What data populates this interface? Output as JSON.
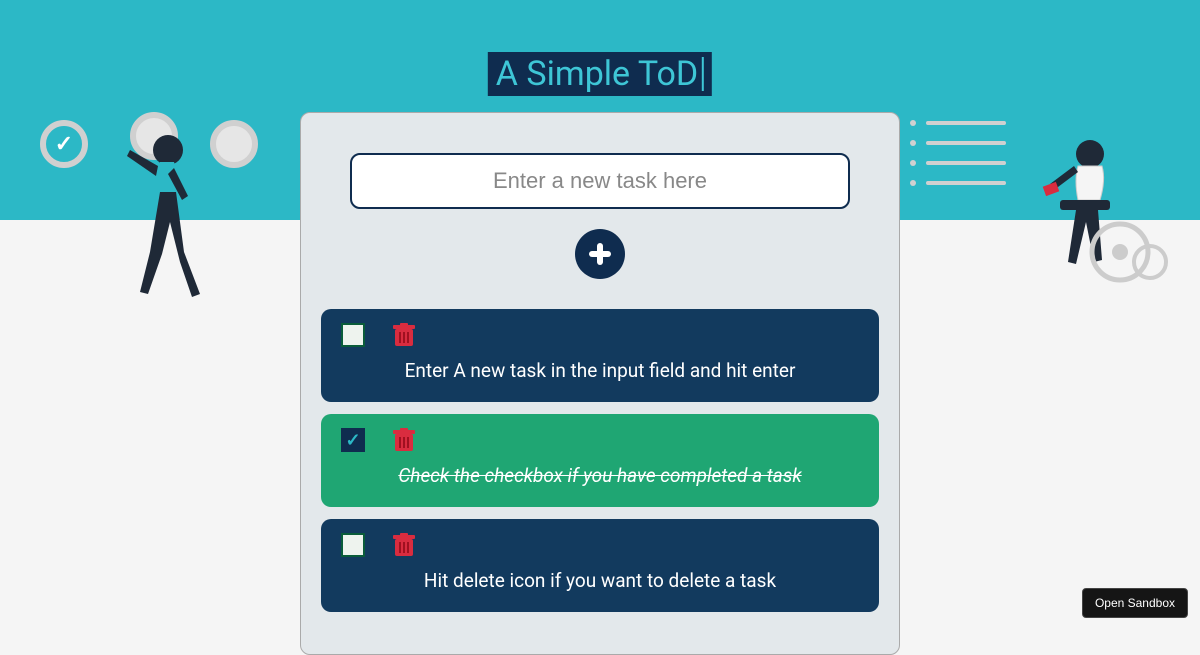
{
  "title": "A Simple ToD",
  "input": {
    "placeholder": "Enter a new task here",
    "value": ""
  },
  "tasks": [
    {
      "text": "Enter A new task in the input field and hit enter",
      "done": false
    },
    {
      "text": "Check the checkbox if you have completed a task",
      "done": true
    },
    {
      "text": "Hit delete icon if you want to delete a task",
      "done": false
    }
  ],
  "colors": {
    "accent": "#2cb8c6",
    "dark": "#0f2c4f",
    "taskPending": "#123a5e",
    "taskDone": "#1fa673",
    "trash": "#d92c3f"
  },
  "sandbox": {
    "label": "Open Sandbox"
  }
}
